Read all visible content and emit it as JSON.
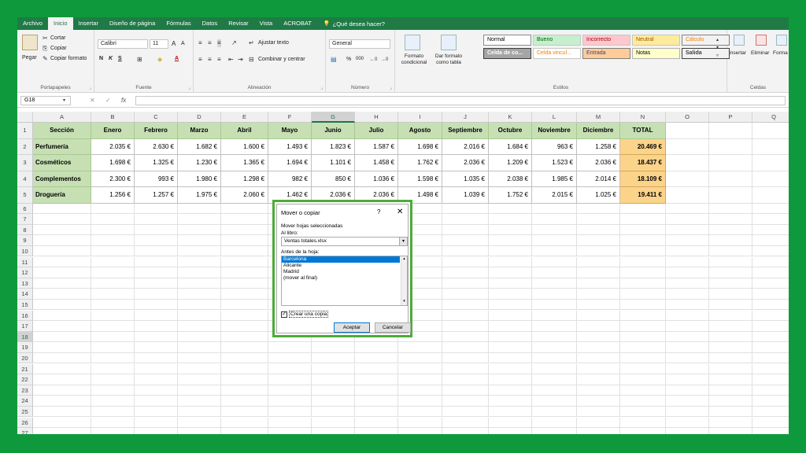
{
  "tabs": [
    "Archivo",
    "Inicio",
    "Insertar",
    "Diseño de página",
    "Fórmulas",
    "Datos",
    "Revisar",
    "Vista",
    "ACROBAT"
  ],
  "active_tab": "Inicio",
  "tell_me": "¿Qué desea hacer?",
  "ribbon": {
    "clipboard": {
      "paste": "Pegar",
      "cut": "Cortar",
      "copy": "Copiar",
      "format_painter": "Copiar formato",
      "label": "Portapapeles"
    },
    "font": {
      "name": "Calibri",
      "size": "11",
      "bold": "N",
      "italic": "K",
      "underline": "S",
      "grow": "A",
      "shrink": "A",
      "color_letter": "A",
      "label": "Fuente"
    },
    "alignment": {
      "wrap": "Ajustar texto",
      "merge": "Combinar y centrar",
      "label": "Alineación"
    },
    "number": {
      "format": "General",
      "percent": "%",
      "thousands": "000",
      "label": "Número"
    },
    "styles": {
      "conditional": "Formato condicional",
      "as_table": "Dar formato como tabla",
      "cells": [
        "Normal",
        "Bueno",
        "Incorrecto",
        "Neutral",
        "Cálculo",
        "Celda de co...",
        "Celda vincul...",
        "Entrada",
        "Notas",
        "Salida"
      ],
      "label": "Estilos"
    },
    "cells": {
      "insert": "Insertar",
      "delete": "Eliminar",
      "format": "Forma",
      "label": "Celdas"
    }
  },
  "name_box": "G18",
  "fx": "fx",
  "columns": [
    "A",
    "B",
    "C",
    "D",
    "E",
    "F",
    "G",
    "H",
    "I",
    "J",
    "K",
    "L",
    "M",
    "N",
    "O",
    "P",
    "Q"
  ],
  "selected_column": "G",
  "rows": [
    "1",
    "2",
    "3",
    "4",
    "5",
    "6",
    "7",
    "8",
    "9",
    "10",
    "11",
    "12",
    "13",
    "14",
    "15",
    "16",
    "17",
    "18",
    "19",
    "20",
    "21",
    "22",
    "23",
    "24",
    "25",
    "26",
    "27"
  ],
  "selected_row": "18",
  "table": {
    "headers": [
      "Sección",
      "Enero",
      "Febrero",
      "Marzo",
      "Abril",
      "Mayo",
      "Junio",
      "Julio",
      "Agosto",
      "Septiembre",
      "Octubre",
      "Noviembre",
      "Diciembre",
      "TOTAL"
    ],
    "rows": [
      [
        "Perfumería",
        "2.035 €",
        "2.630 €",
        "1.682 €",
        "1.600 €",
        "1.493 €",
        "1.823 €",
        "1.587 €",
        "1.698 €",
        "2.016 €",
        "1.684 €",
        "963 €",
        "1.258 €",
        "20.469 €"
      ],
      [
        "Cosméticos",
        "1.698 €",
        "1.325 €",
        "1.230 €",
        "1.365 €",
        "1.694 €",
        "1.101 €",
        "1.458 €",
        "1.762 €",
        "2.036 €",
        "1.209 €",
        "1.523 €",
        "2.036 €",
        "18.437 €"
      ],
      [
        "Complementos",
        "2.300 €",
        "993 €",
        "1.980 €",
        "1.298 €",
        "982 €",
        "850 €",
        "1.036 €",
        "1.598 €",
        "1.035 €",
        "2.038 €",
        "1.985 €",
        "2.014 €",
        "18.109 €"
      ],
      [
        "Droguería",
        "1.256 €",
        "1.257 €",
        "1.975 €",
        "2.060 €",
        "1.462 €",
        "2.036 €",
        "2.036 €",
        "1.498 €",
        "1.039 €",
        "1.752 €",
        "2.015 €",
        "1.025 €",
        "19.411 €"
      ]
    ]
  },
  "dialog": {
    "title": "Mover o copiar",
    "help": "?",
    "close": "✕",
    "move_label": "Mover hojas seleccionadas",
    "book_label": "Al libro:",
    "book_value": "Ventas totales.xlsx",
    "before_label": "Antes de la hoja:",
    "sheets": [
      "Barcelona",
      "Alicante",
      "Madrid",
      "(mover al final)"
    ],
    "selected_sheet": "Barcelona",
    "copy_label": "Crear una copia",
    "copy_checked": true,
    "ok": "Aceptar",
    "cancel": "Cancelar"
  },
  "colors": {
    "brand_green": "#217346",
    "frame_green": "#4cac37",
    "header_fill": "#c6e0b4",
    "total_fill": "#fcd38a"
  }
}
